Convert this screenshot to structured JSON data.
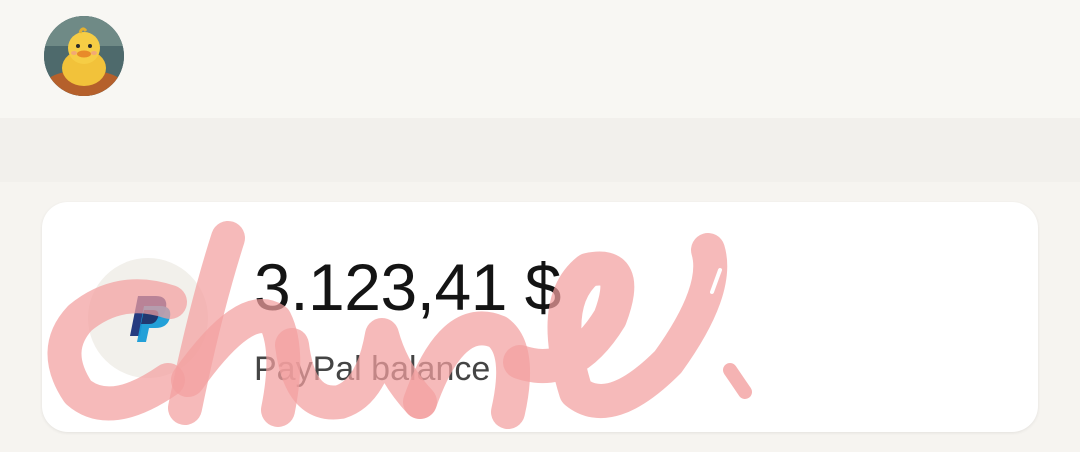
{
  "profile": {
    "avatar_icon": "duck-avatar-icon"
  },
  "balance_card": {
    "amount": "3.123,41 $",
    "label": "PayPal balance",
    "logo_icon": "paypal-logo-icon",
    "brand_colors": {
      "dark_blue": "#253B80",
      "light_blue": "#179BD7"
    }
  },
  "watermark": {
    "color": "#f2a0a0"
  }
}
